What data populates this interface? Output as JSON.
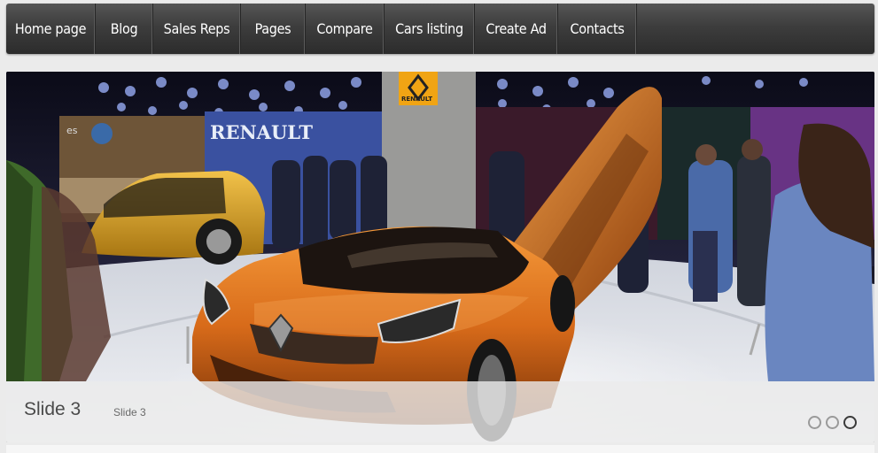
{
  "nav": {
    "items": [
      {
        "label": "Home page"
      },
      {
        "label": "Blog"
      },
      {
        "label": "Sales Reps"
      },
      {
        "label": "Pages"
      },
      {
        "label": "Compare"
      },
      {
        "label": "Cars listing"
      },
      {
        "label": "Create Ad"
      },
      {
        "label": "Contacts"
      }
    ]
  },
  "slider": {
    "title": "Slide 3",
    "subtitle": "Slide 3",
    "current_slide": 3,
    "slide_count": 3,
    "brand_sign": "RENAULT",
    "booth_sign": "RENAULT",
    "background_sign": "es"
  },
  "colors": {
    "nav_bg": "#3d3d3d",
    "car_orange": "#d86b1a",
    "caption_bg": "#ebebeb",
    "dot_active": "#3a3a3a"
  }
}
